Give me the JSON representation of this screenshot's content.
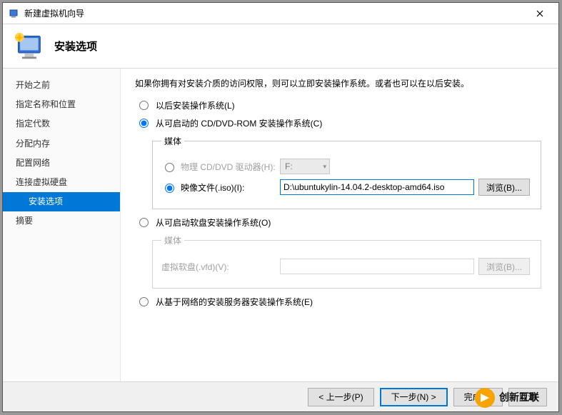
{
  "window": {
    "title": "新建虚拟机向导"
  },
  "header": {
    "heading": "安装选项"
  },
  "sidebar": {
    "items": [
      {
        "label": "开始之前"
      },
      {
        "label": "指定名称和位置"
      },
      {
        "label": "指定代数"
      },
      {
        "label": "分配内存"
      },
      {
        "label": "配置网络"
      },
      {
        "label": "连接虚拟硬盘"
      },
      {
        "label": "安装选项"
      },
      {
        "label": "摘要"
      }
    ],
    "active_index": 6
  },
  "content": {
    "intro": "如果你拥有对安装介质的访问权限，则可以立即安装操作系统。或者也可以在以后安装。",
    "options": {
      "later": {
        "label": "以后安装操作系统(L)",
        "checked": false
      },
      "cddvd": {
        "label": "从可启动的 CD/DVD-ROM 安装操作系统(C)",
        "checked": true
      },
      "floppy": {
        "label": "从可启动软盘安装操作系统(O)",
        "checked": false
      },
      "network": {
        "label": "从基于网络的安装服务器安装操作系统(E)",
        "checked": false
      }
    },
    "media_cddvd": {
      "legend": "媒体",
      "physical": {
        "label": "物理 CD/DVD 驱动器(H):",
        "checked": false,
        "drive": "F:"
      },
      "iso": {
        "label": "映像文件(.iso)(I):",
        "checked": true,
        "path": "D:\\ubuntukylin-14.04.2-desktop-amd64.iso"
      },
      "browse": "浏览(B)..."
    },
    "media_floppy": {
      "legend": "媒体",
      "vfd_label": "虚拟软盘(.vfd)(V):",
      "vfd_path": "",
      "browse": "浏览(B)..."
    }
  },
  "footer": {
    "prev": "< 上一步(P)",
    "next": "下一步(N) >",
    "finish": "完成(F)",
    "cancel": "取消"
  },
  "watermark": "创新互联"
}
